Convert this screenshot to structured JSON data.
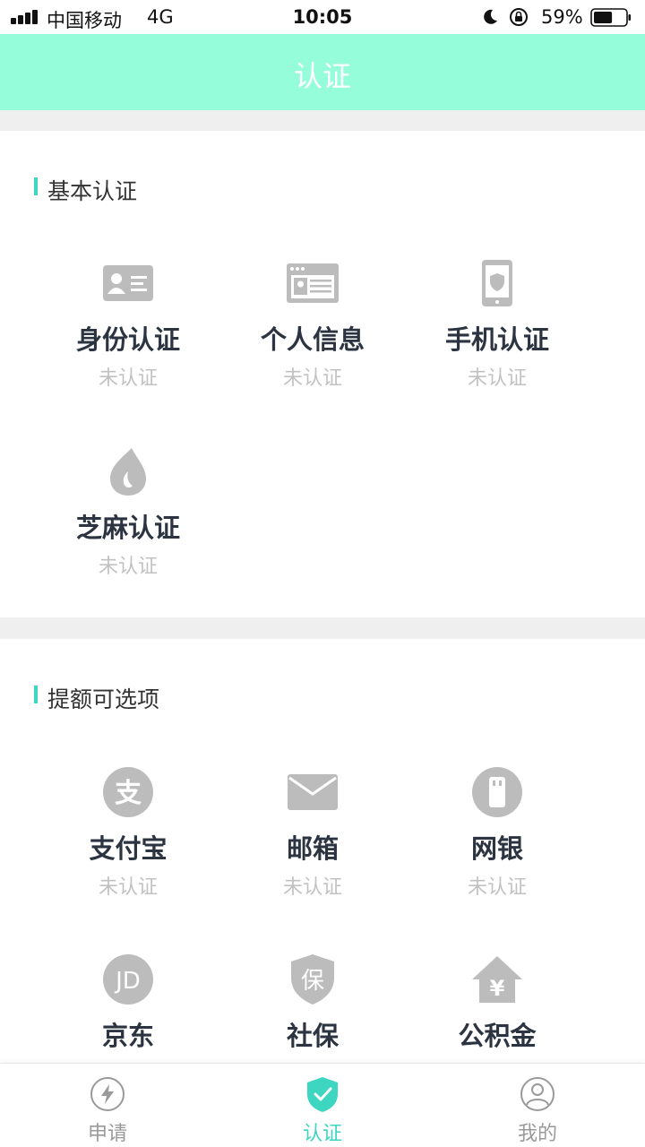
{
  "status_bar": {
    "carrier": "中国移动",
    "network": "4G",
    "time": "10:05",
    "battery_percent_text": "59%",
    "battery_level": 0.59
  },
  "header": {
    "title": "认证"
  },
  "basic_section": {
    "title": "基本认证",
    "items": [
      {
        "name": "身份认证",
        "status": "未认证",
        "icon": "id-card-icon"
      },
      {
        "name": "个人信息",
        "status": "未认证",
        "icon": "personal-info-icon"
      },
      {
        "name": "手机认证",
        "status": "未认证",
        "icon": "phone-shield-icon"
      },
      {
        "name": "芝麻认证",
        "status": "未认证",
        "icon": "sesame-icon"
      }
    ]
  },
  "optional_section": {
    "title": "提额可选项",
    "items": [
      {
        "name": "支付宝",
        "status": "未认证",
        "icon": "alipay-icon"
      },
      {
        "name": "邮箱",
        "status": "未认证",
        "icon": "mail-icon"
      },
      {
        "name": "网银",
        "status": "未认证",
        "icon": "bank-card-icon"
      },
      {
        "name": "京东",
        "status": "",
        "icon": "jd-icon"
      },
      {
        "name": "社保",
        "status": "",
        "icon": "social-security-icon"
      },
      {
        "name": "公积金",
        "status": "",
        "icon": "housing-fund-icon"
      }
    ]
  },
  "tab_bar": {
    "tabs": [
      {
        "label": "申请",
        "icon": "lightning-icon",
        "active": false
      },
      {
        "label": "认证",
        "icon": "shield-check-icon",
        "active": true
      },
      {
        "label": "我的",
        "icon": "user-icon",
        "active": false
      }
    ]
  },
  "colors": {
    "header_bg": "#96fddb",
    "accent": "#3dd6c1",
    "icon_gray": "#bcbcbc",
    "status_gray": "#c2c2c2"
  }
}
